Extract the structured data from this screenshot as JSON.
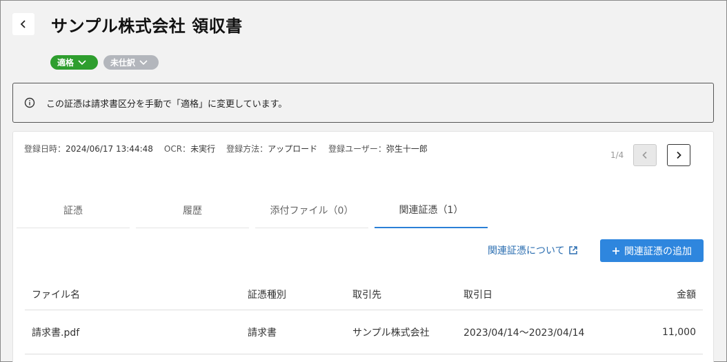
{
  "header": {
    "title": "サンプル株式会社 領収書",
    "badges": [
      {
        "label": "適格",
        "color": "#2e9e2e"
      },
      {
        "label": "未仕訳",
        "color": "#b3b6bc"
      }
    ]
  },
  "notice": {
    "text": "この証憑は請求書区分を手動で「適格」に変更しています。"
  },
  "meta": {
    "registered_at_label": "登録日時：",
    "registered_at": "2024/06/17 13:44:48",
    "ocr_label": "OCR：",
    "ocr": "未実行",
    "method_label": "登録方法：",
    "method": "アップロード",
    "user_label": "登録ユーザー：",
    "user": "弥生十一郎"
  },
  "pager": {
    "count": "1/4"
  },
  "tabs": [
    {
      "label": "証憑"
    },
    {
      "label": "履歴"
    },
    {
      "label": "添付ファイル（0）"
    },
    {
      "label": "関連証憑（1）",
      "active": true
    }
  ],
  "related": {
    "about_link": "関連証憑について",
    "add_button": "関連証憑の追加"
  },
  "table": {
    "headers": [
      "ファイル名",
      "証憑種別",
      "取引先",
      "取引日",
      "金額"
    ],
    "rows": [
      [
        "請求書.pdf",
        "請求書",
        "サンプル株式会社",
        "2023/04/14〜2023/04/14",
        "11,000"
      ]
    ]
  },
  "colors": {
    "accent": "#2e86de",
    "link": "#2a6db0",
    "qualified": "#2e9e2e",
    "unjournaled": "#b3b6bc"
  }
}
